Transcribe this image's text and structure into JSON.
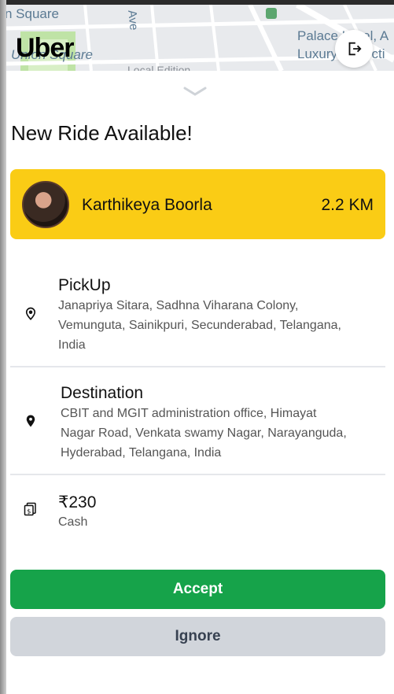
{
  "app": {
    "logo_text": "Uber"
  },
  "map": {
    "labels": {
      "square": "n Square",
      "union_square": "Union Square",
      "ave": "Ave",
      "palace": "Palace Hotel, A",
      "luxury": "Luxury Collecti",
      "local_edition": "Local Edition"
    }
  },
  "header": {
    "title": "New Ride Available!"
  },
  "rider": {
    "name": "Karthikeya Boorla",
    "distance": "2.2 KM"
  },
  "pickup": {
    "label": "PickUp",
    "address_lines": [
      "Janapriya Sitara, Sadhna Viharana Colony,",
      "Vemunguta, Sainikpuri, Secunderabad, Telangana,",
      "India"
    ]
  },
  "destination": {
    "label": "Destination",
    "address_lines": [
      "CBIT and MGIT administration office, Himayat",
      "Nagar Road, Venkata swamy Nagar, Narayanguda,",
      "Hyderabad, Telangana, India"
    ]
  },
  "fare": {
    "amount": "₹230",
    "method": "Cash"
  },
  "actions": {
    "accept_label": "Accept",
    "ignore_label": "Ignore"
  },
  "colors": {
    "rider_card": "#facc15",
    "accept": "#16a34a",
    "ignore": "#d1d5db"
  },
  "icons": {
    "exit": "logout-icon",
    "collapse": "chevron-down-icon",
    "pickup": "pickup-pin-icon",
    "destination": "location-pin-icon",
    "fare": "cash-icon"
  }
}
